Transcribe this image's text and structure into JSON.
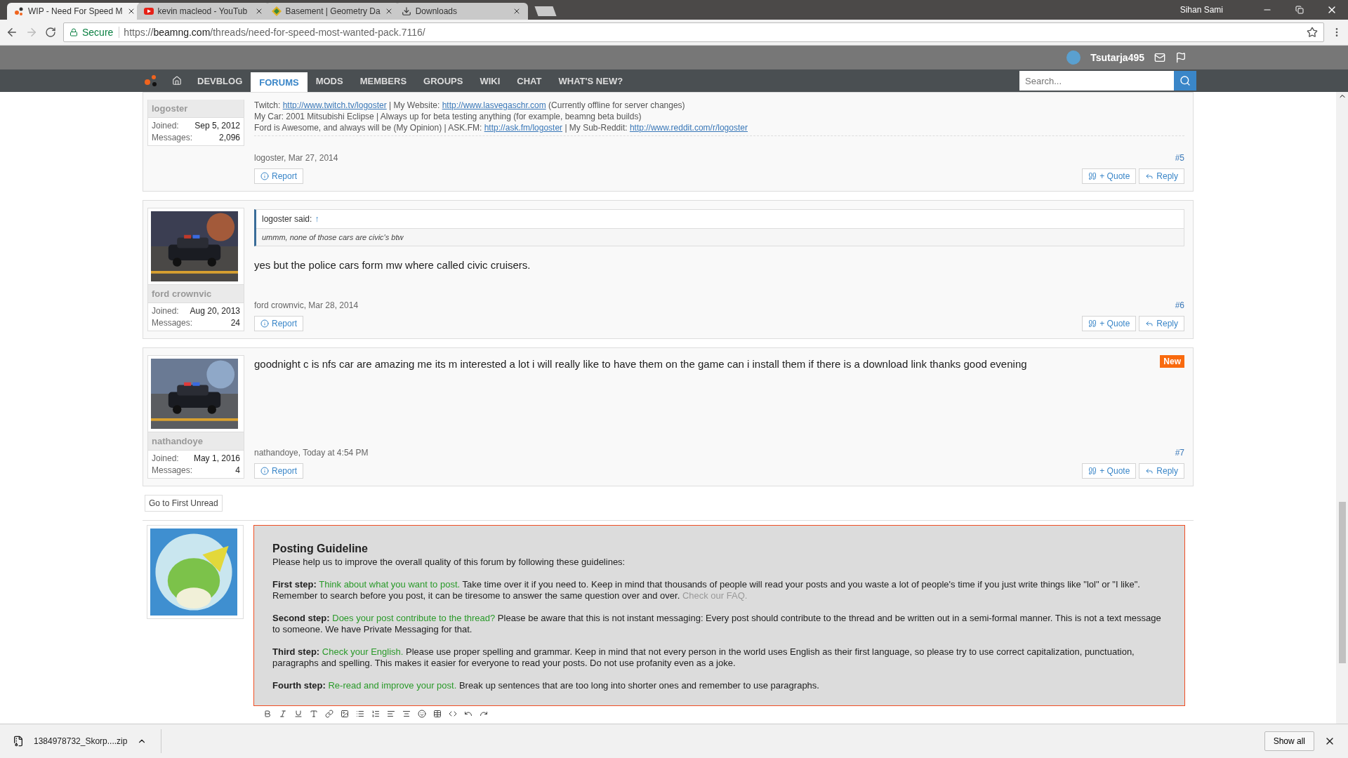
{
  "browser": {
    "tabs": [
      {
        "title": "WIP - Need For Speed M",
        "selected": true
      },
      {
        "title": "kevin macleod - YouTub",
        "selected": false
      },
      {
        "title": "Basement | Geometry Da",
        "selected": false
      },
      {
        "title": "Downloads",
        "selected": false
      }
    ],
    "profile": "Sihan Sami",
    "secure_label": "Secure",
    "url": {
      "scheme": "https://",
      "domain": "beamng.com",
      "path": "/threads/need-for-speed-most-wanted-pack.7116/"
    }
  },
  "site": {
    "username": "Tsutarja495",
    "nav": [
      {
        "label": "DEVBLOG",
        "selected": false
      },
      {
        "label": "FORUMS",
        "selected": true
      },
      {
        "label": "MODS",
        "selected": false
      },
      {
        "label": "MEMBERS",
        "selected": false
      },
      {
        "label": "GROUPS",
        "selected": false
      },
      {
        "label": "WIKI",
        "selected": false
      },
      {
        "label": "CHAT",
        "selected": false
      },
      {
        "label": "WHAT'S NEW?",
        "selected": false
      }
    ],
    "search": {
      "placeholder": "Search..."
    }
  },
  "posts": [
    {
      "author": "logoster",
      "joined_label": "Joined:",
      "joined": "Sep 5, 2012",
      "messages_label": "Messages:",
      "messages": "2,096",
      "signature": [
        [
          {
            "kind": "text",
            "text": "Twitch: "
          },
          {
            "kind": "link",
            "text": "http://www.twitch.tv/logoster"
          },
          {
            "kind": "text",
            "text": " | My Website: "
          },
          {
            "kind": "link",
            "text": "http://www.lasvegaschr.com"
          },
          {
            "kind": "text",
            "text": " (Currently offline for server changes)"
          }
        ],
        [
          {
            "kind": "text",
            "text": "My Car: 2001 Mitsubishi Eclipse | Always up for beta testing anything (for example, beamng beta builds)"
          }
        ],
        [
          {
            "kind": "text",
            "text": "Ford is Awesome, and always will be (My Opinion) | ASK.FM: "
          },
          {
            "kind": "link",
            "text": "http://ask.fm/logoster"
          },
          {
            "kind": "text",
            "text": " | My Sub-Reddit: "
          },
          {
            "kind": "link",
            "text": "http://www.reddit.com/r/logoster"
          }
        ]
      ],
      "meta": "logoster, Mar 27, 2014",
      "number": "#5",
      "report": "Report",
      "quote": "+ Quote",
      "reply": "Reply"
    },
    {
      "author": "ford crownvic",
      "joined_label": "Joined:",
      "joined": "Aug 20, 2013",
      "messages_label": "Messages:",
      "messages": "24",
      "quote_block": {
        "attribution": "logoster said:",
        "arrow": "↑",
        "text": "ummm, none of those cars are civic's btw"
      },
      "body": "yes but the police cars form mw where called civic cruisers.",
      "meta": "ford crownvic, Mar 28, 2014",
      "number": "#6",
      "report": "Report",
      "quote": "+ Quote",
      "reply": "Reply"
    },
    {
      "author": "nathandoye",
      "joined_label": "Joined:",
      "joined": "May 1, 2016",
      "messages_label": "Messages:",
      "messages": "4",
      "badge": "New",
      "body": "goodnight c is nfs car are amazing me its m interested a lot i will really like to have them on the game can i install them if there is a download link thanks good evening",
      "meta": "nathandoye, Today at 4:54 PM",
      "number": "#7",
      "report": "Report",
      "quote": "+ Quote",
      "reply": "Reply"
    }
  ],
  "go_first_unread": "Go to First Unread",
  "reply_box": {
    "guideline": {
      "title": "Posting Guideline",
      "intro": "Please help us to improve the overall quality of this forum by following these guidelines:",
      "steps": [
        {
          "label": "First step:",
          "highlight": "Think about what you want to post.",
          "text": " Take time over it if you need to. Keep in mind that thousands of people will read your posts and you waste a lot of people's time if you just write things like \"lol\" or \"I like\". Remember to search before you post, it can be tiresome to answer the same question over and over. ",
          "faq": "Check our FAQ."
        },
        {
          "label": "Second step:",
          "highlight": "Does your post contribute to the thread?",
          "text": " Please be aware that this is not instant messaging: Every post should contribute to the thread and be written out in a semi-formal manner. This is not a text message to someone. We have Private Messaging for that."
        },
        {
          "label": "Third step:",
          "highlight": "Check your English.",
          "text": " Please use proper spelling and grammar. Keep in mind that not every person in the world uses English as their first language, so please try to use correct capitalization, punctuation, paragraphs and spelling. This makes it easier for everyone to read your posts. Do not use profanity even as a joke."
        },
        {
          "label": "Fourth step:",
          "highlight": "Re-read and improve your post.",
          "text": " Break up sentences that are too long into shorter ones and remember to use paragraphs."
        }
      ]
    }
  },
  "download_bar": {
    "file": "1384978732_Skorp....zip",
    "show_all": "Show all"
  }
}
